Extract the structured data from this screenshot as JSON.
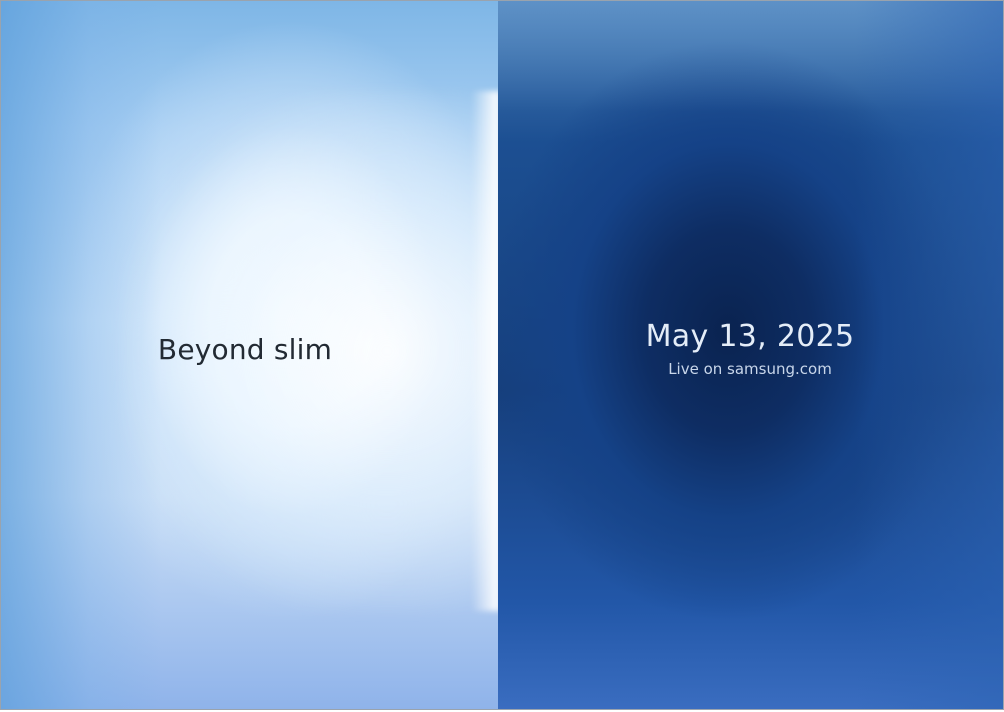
{
  "banner": {
    "tagline": "Beyond slim",
    "date": "May 13, 2025",
    "subtext": "Live on samsung.com"
  },
  "colors": {
    "left_light": "#f8fcff",
    "left_blue": "#7eb6e6",
    "right_dark": "#0a2350",
    "right_blue": "#2257a8",
    "tagline_text": "#222a33",
    "date_text": "#e4edf8"
  }
}
